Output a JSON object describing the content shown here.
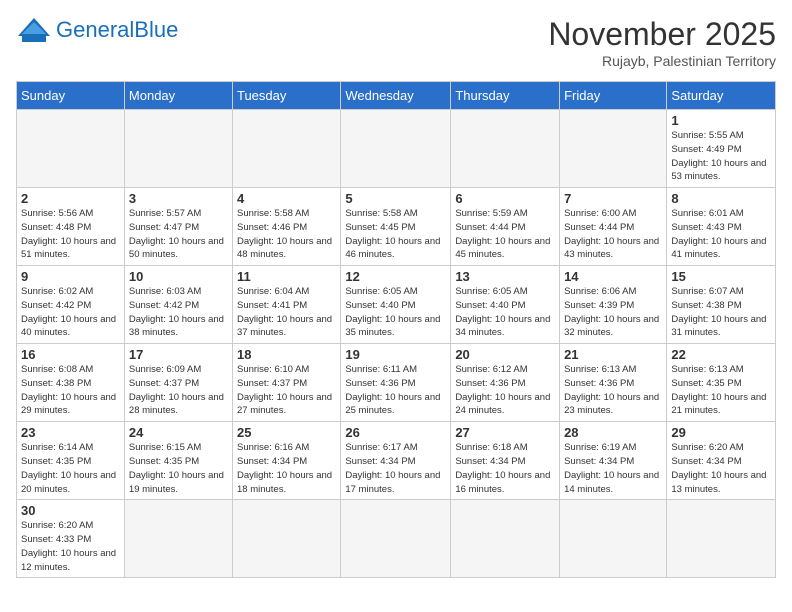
{
  "header": {
    "logo_general": "General",
    "logo_blue": "Blue",
    "month_title": "November 2025",
    "location": "Rujayb, Palestinian Territory"
  },
  "weekdays": [
    "Sunday",
    "Monday",
    "Tuesday",
    "Wednesday",
    "Thursday",
    "Friday",
    "Saturday"
  ],
  "weeks": [
    [
      {
        "day": "",
        "info": ""
      },
      {
        "day": "",
        "info": ""
      },
      {
        "day": "",
        "info": ""
      },
      {
        "day": "",
        "info": ""
      },
      {
        "day": "",
        "info": ""
      },
      {
        "day": "",
        "info": ""
      },
      {
        "day": "1",
        "info": "Sunrise: 5:55 AM\nSunset: 4:49 PM\nDaylight: 10 hours and 53 minutes."
      }
    ],
    [
      {
        "day": "2",
        "info": "Sunrise: 5:56 AM\nSunset: 4:48 PM\nDaylight: 10 hours and 51 minutes."
      },
      {
        "day": "3",
        "info": "Sunrise: 5:57 AM\nSunset: 4:47 PM\nDaylight: 10 hours and 50 minutes."
      },
      {
        "day": "4",
        "info": "Sunrise: 5:58 AM\nSunset: 4:46 PM\nDaylight: 10 hours and 48 minutes."
      },
      {
        "day": "5",
        "info": "Sunrise: 5:58 AM\nSunset: 4:45 PM\nDaylight: 10 hours and 46 minutes."
      },
      {
        "day": "6",
        "info": "Sunrise: 5:59 AM\nSunset: 4:44 PM\nDaylight: 10 hours and 45 minutes."
      },
      {
        "day": "7",
        "info": "Sunrise: 6:00 AM\nSunset: 4:44 PM\nDaylight: 10 hours and 43 minutes."
      },
      {
        "day": "8",
        "info": "Sunrise: 6:01 AM\nSunset: 4:43 PM\nDaylight: 10 hours and 41 minutes."
      }
    ],
    [
      {
        "day": "9",
        "info": "Sunrise: 6:02 AM\nSunset: 4:42 PM\nDaylight: 10 hours and 40 minutes."
      },
      {
        "day": "10",
        "info": "Sunrise: 6:03 AM\nSunset: 4:42 PM\nDaylight: 10 hours and 38 minutes."
      },
      {
        "day": "11",
        "info": "Sunrise: 6:04 AM\nSunset: 4:41 PM\nDaylight: 10 hours and 37 minutes."
      },
      {
        "day": "12",
        "info": "Sunrise: 6:05 AM\nSunset: 4:40 PM\nDaylight: 10 hours and 35 minutes."
      },
      {
        "day": "13",
        "info": "Sunrise: 6:05 AM\nSunset: 4:40 PM\nDaylight: 10 hours and 34 minutes."
      },
      {
        "day": "14",
        "info": "Sunrise: 6:06 AM\nSunset: 4:39 PM\nDaylight: 10 hours and 32 minutes."
      },
      {
        "day": "15",
        "info": "Sunrise: 6:07 AM\nSunset: 4:38 PM\nDaylight: 10 hours and 31 minutes."
      }
    ],
    [
      {
        "day": "16",
        "info": "Sunrise: 6:08 AM\nSunset: 4:38 PM\nDaylight: 10 hours and 29 minutes."
      },
      {
        "day": "17",
        "info": "Sunrise: 6:09 AM\nSunset: 4:37 PM\nDaylight: 10 hours and 28 minutes."
      },
      {
        "day": "18",
        "info": "Sunrise: 6:10 AM\nSunset: 4:37 PM\nDaylight: 10 hours and 27 minutes."
      },
      {
        "day": "19",
        "info": "Sunrise: 6:11 AM\nSunset: 4:36 PM\nDaylight: 10 hours and 25 minutes."
      },
      {
        "day": "20",
        "info": "Sunrise: 6:12 AM\nSunset: 4:36 PM\nDaylight: 10 hours and 24 minutes."
      },
      {
        "day": "21",
        "info": "Sunrise: 6:13 AM\nSunset: 4:36 PM\nDaylight: 10 hours and 23 minutes."
      },
      {
        "day": "22",
        "info": "Sunrise: 6:13 AM\nSunset: 4:35 PM\nDaylight: 10 hours and 21 minutes."
      }
    ],
    [
      {
        "day": "23",
        "info": "Sunrise: 6:14 AM\nSunset: 4:35 PM\nDaylight: 10 hours and 20 minutes."
      },
      {
        "day": "24",
        "info": "Sunrise: 6:15 AM\nSunset: 4:35 PM\nDaylight: 10 hours and 19 minutes."
      },
      {
        "day": "25",
        "info": "Sunrise: 6:16 AM\nSunset: 4:34 PM\nDaylight: 10 hours and 18 minutes."
      },
      {
        "day": "26",
        "info": "Sunrise: 6:17 AM\nSunset: 4:34 PM\nDaylight: 10 hours and 17 minutes."
      },
      {
        "day": "27",
        "info": "Sunrise: 6:18 AM\nSunset: 4:34 PM\nDaylight: 10 hours and 16 minutes."
      },
      {
        "day": "28",
        "info": "Sunrise: 6:19 AM\nSunset: 4:34 PM\nDaylight: 10 hours and 14 minutes."
      },
      {
        "day": "29",
        "info": "Sunrise: 6:20 AM\nSunset: 4:34 PM\nDaylight: 10 hours and 13 minutes."
      }
    ],
    [
      {
        "day": "30",
        "info": "Sunrise: 6:20 AM\nSunset: 4:33 PM\nDaylight: 10 hours and 12 minutes."
      },
      {
        "day": "",
        "info": ""
      },
      {
        "day": "",
        "info": ""
      },
      {
        "day": "",
        "info": ""
      },
      {
        "day": "",
        "info": ""
      },
      {
        "day": "",
        "info": ""
      },
      {
        "day": "",
        "info": ""
      }
    ]
  ]
}
